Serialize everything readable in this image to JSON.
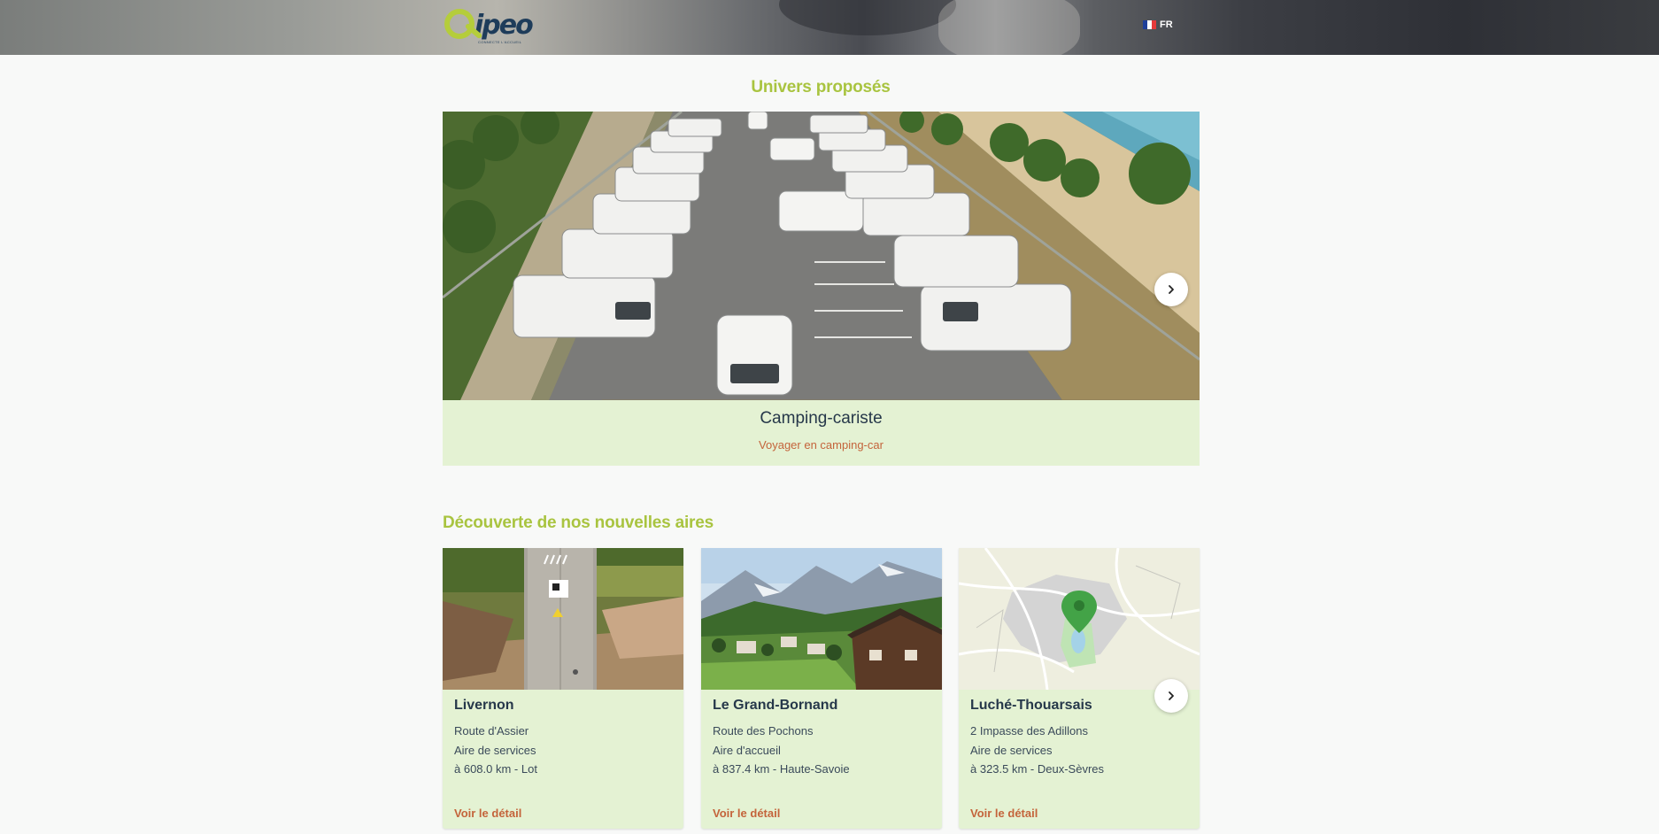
{
  "header": {
    "logo_text": "ipeo",
    "logo_subtext": "CONNECTE L'ACCUEIL",
    "language": "FR",
    "flag_colors": [
      "#1f3f99",
      "#ffffff",
      "#e63a3a"
    ]
  },
  "univers": {
    "title": "Univers proposés",
    "slide": {
      "title": "Camping-cariste",
      "subtitle": "Voyager en camping-car",
      "image": "aerial-motorhome-parking-by-the-beach"
    },
    "next_icon": "chevron-right-icon"
  },
  "discovery": {
    "title": "Découverte de nos nouvelles aires",
    "cards": [
      {
        "name": "Livernon",
        "address": "Route d'Assier",
        "type": "Aire de services",
        "distance": "à 608.0 km - Lot",
        "link": "Voir le détail",
        "image": "service-terminal-in-nature"
      },
      {
        "name": "Le Grand-Bornand",
        "address": "Route des Pochons",
        "type": "Aire d'accueil",
        "distance": "à 837.4 km - Haute-Savoie",
        "link": "Voir le détail",
        "image": "alpine-village-chalets"
      },
      {
        "name": "Luché-Thouarsais",
        "address": "2 Impasse des Adillons",
        "type": "Aire de services",
        "distance": "à 323.5 km - Deux-Sèvres",
        "link": "Voir le détail",
        "image": "map-with-location-pin"
      }
    ],
    "next_icon": "chevron-right-icon"
  },
  "colors": {
    "accent_green": "#a9c440",
    "card_background": "#e4f2d3",
    "link_orange": "#c4643b",
    "title_navy": "#26384a"
  }
}
